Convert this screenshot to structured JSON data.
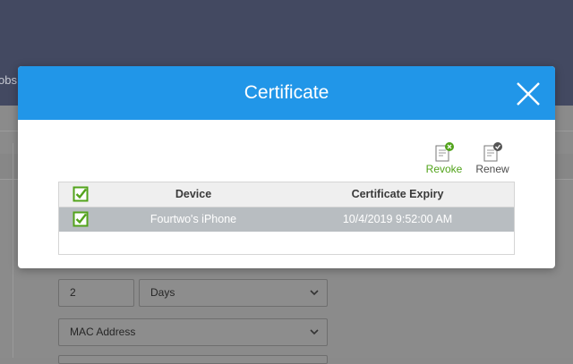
{
  "background": {
    "tab_fragment": "obs",
    "fields": {
      "number_value": "2",
      "unit_value": "Days",
      "mac_value": "MAC Address"
    }
  },
  "modal": {
    "title": "Certificate",
    "actions": {
      "revoke_label": "Revoke",
      "renew_label": "Renew"
    },
    "table": {
      "headers": {
        "device": "Device",
        "expiry": "Certificate Expiry"
      },
      "rows": [
        {
          "device": "Fourtwo's iPhone",
          "expiry": "10/4/2019 9:52:00 AM",
          "checked": true
        }
      ],
      "select_all_checked": true
    }
  },
  "colors": {
    "header_bg": "#434961",
    "modal_header": "#2196e8",
    "revoke": "#52a31b",
    "checkbox": "#52a31b",
    "selected_row": "#b8bdc1"
  },
  "icons": {
    "close": "close-icon",
    "revoke": "certificate-revoke-icon",
    "renew": "certificate-renew-icon",
    "checkbox": "checkbox-checked-icon",
    "dropdown": "chevron-down-icon"
  }
}
